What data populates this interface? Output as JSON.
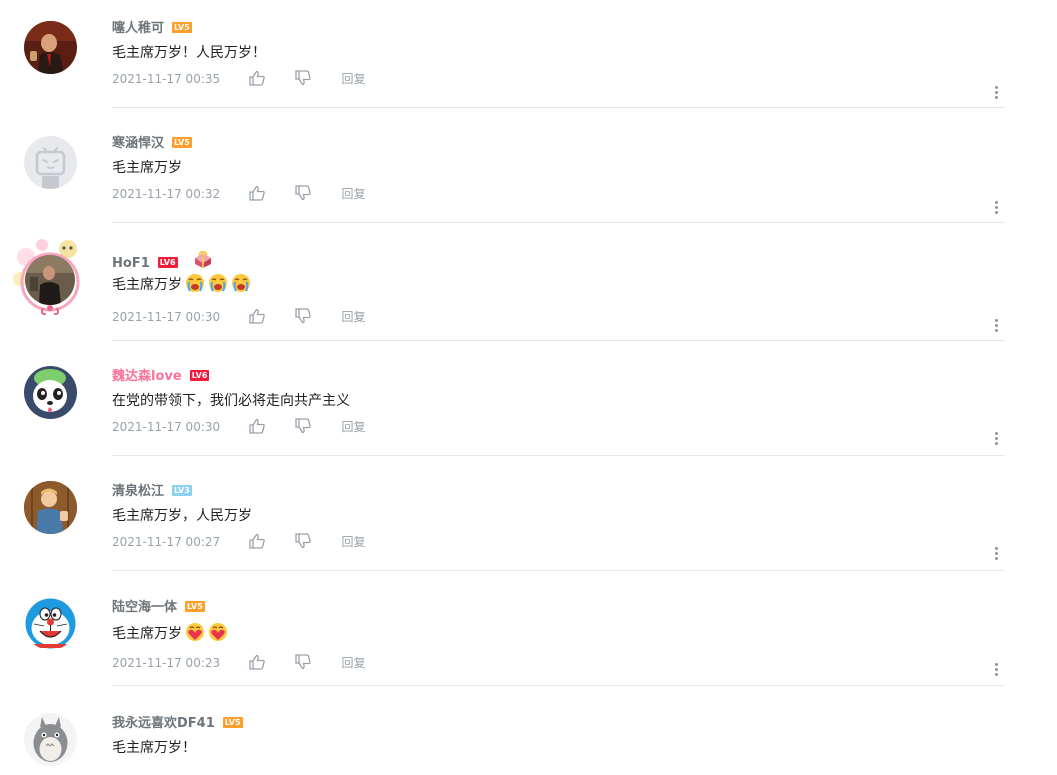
{
  "reply_label": "回复",
  "comments": [
    {
      "username": "噻人稚可",
      "level": "LV5",
      "text": "毛主席万岁！人民万岁！",
      "timestamp": "2021-11-17 00:35",
      "avatar": "portrait-photo"
    },
    {
      "username": "寒涵悍汉",
      "level": "LV5",
      "text": "毛主席万岁",
      "timestamp": "2021-11-17 00:32",
      "avatar": "default-tv-avatar"
    },
    {
      "username": "HoF1",
      "level": "LV6",
      "text": "毛主席万岁",
      "emojis": [
        "crying-emoji",
        "crying-emoji",
        "crying-emoji"
      ],
      "timestamp": "2021-11-17 00:30",
      "avatar": "person-photo-with-frame",
      "badge": "gift-badge-icon"
    },
    {
      "username": "魏达森love",
      "level": "LV6",
      "text": "在党的带领下，我们必将走向共产主义",
      "timestamp": "2021-11-17 00:30",
      "avatar": "panda-avatar",
      "vip": true
    },
    {
      "username": "清泉松江",
      "level": "LV3",
      "text": "毛主席万岁，人民万岁",
      "timestamp": "2021-11-17 00:27",
      "avatar": "cartoon-man-avatar"
    },
    {
      "username": "陆空海一体",
      "level": "LV5",
      "text": "毛主席万岁",
      "emojis": [
        "heart-face-emoji",
        "heart-face-emoji"
      ],
      "timestamp": "2021-11-17 00:23",
      "avatar": "doraemon-avatar"
    },
    {
      "username": "我永远喜欢DF41",
      "level": "LV5",
      "text": "毛主席万岁！",
      "timestamp": "",
      "avatar": "totoro-avatar"
    }
  ],
  "colors": {
    "username": "#6d757a",
    "vip_username": "#fb7299",
    "meta": "#99a2aa",
    "divider": "#e5e9ef",
    "lv3": "#8ed0f0",
    "lv5": "#ff9f2b",
    "lv6": "#ee1c3b"
  }
}
